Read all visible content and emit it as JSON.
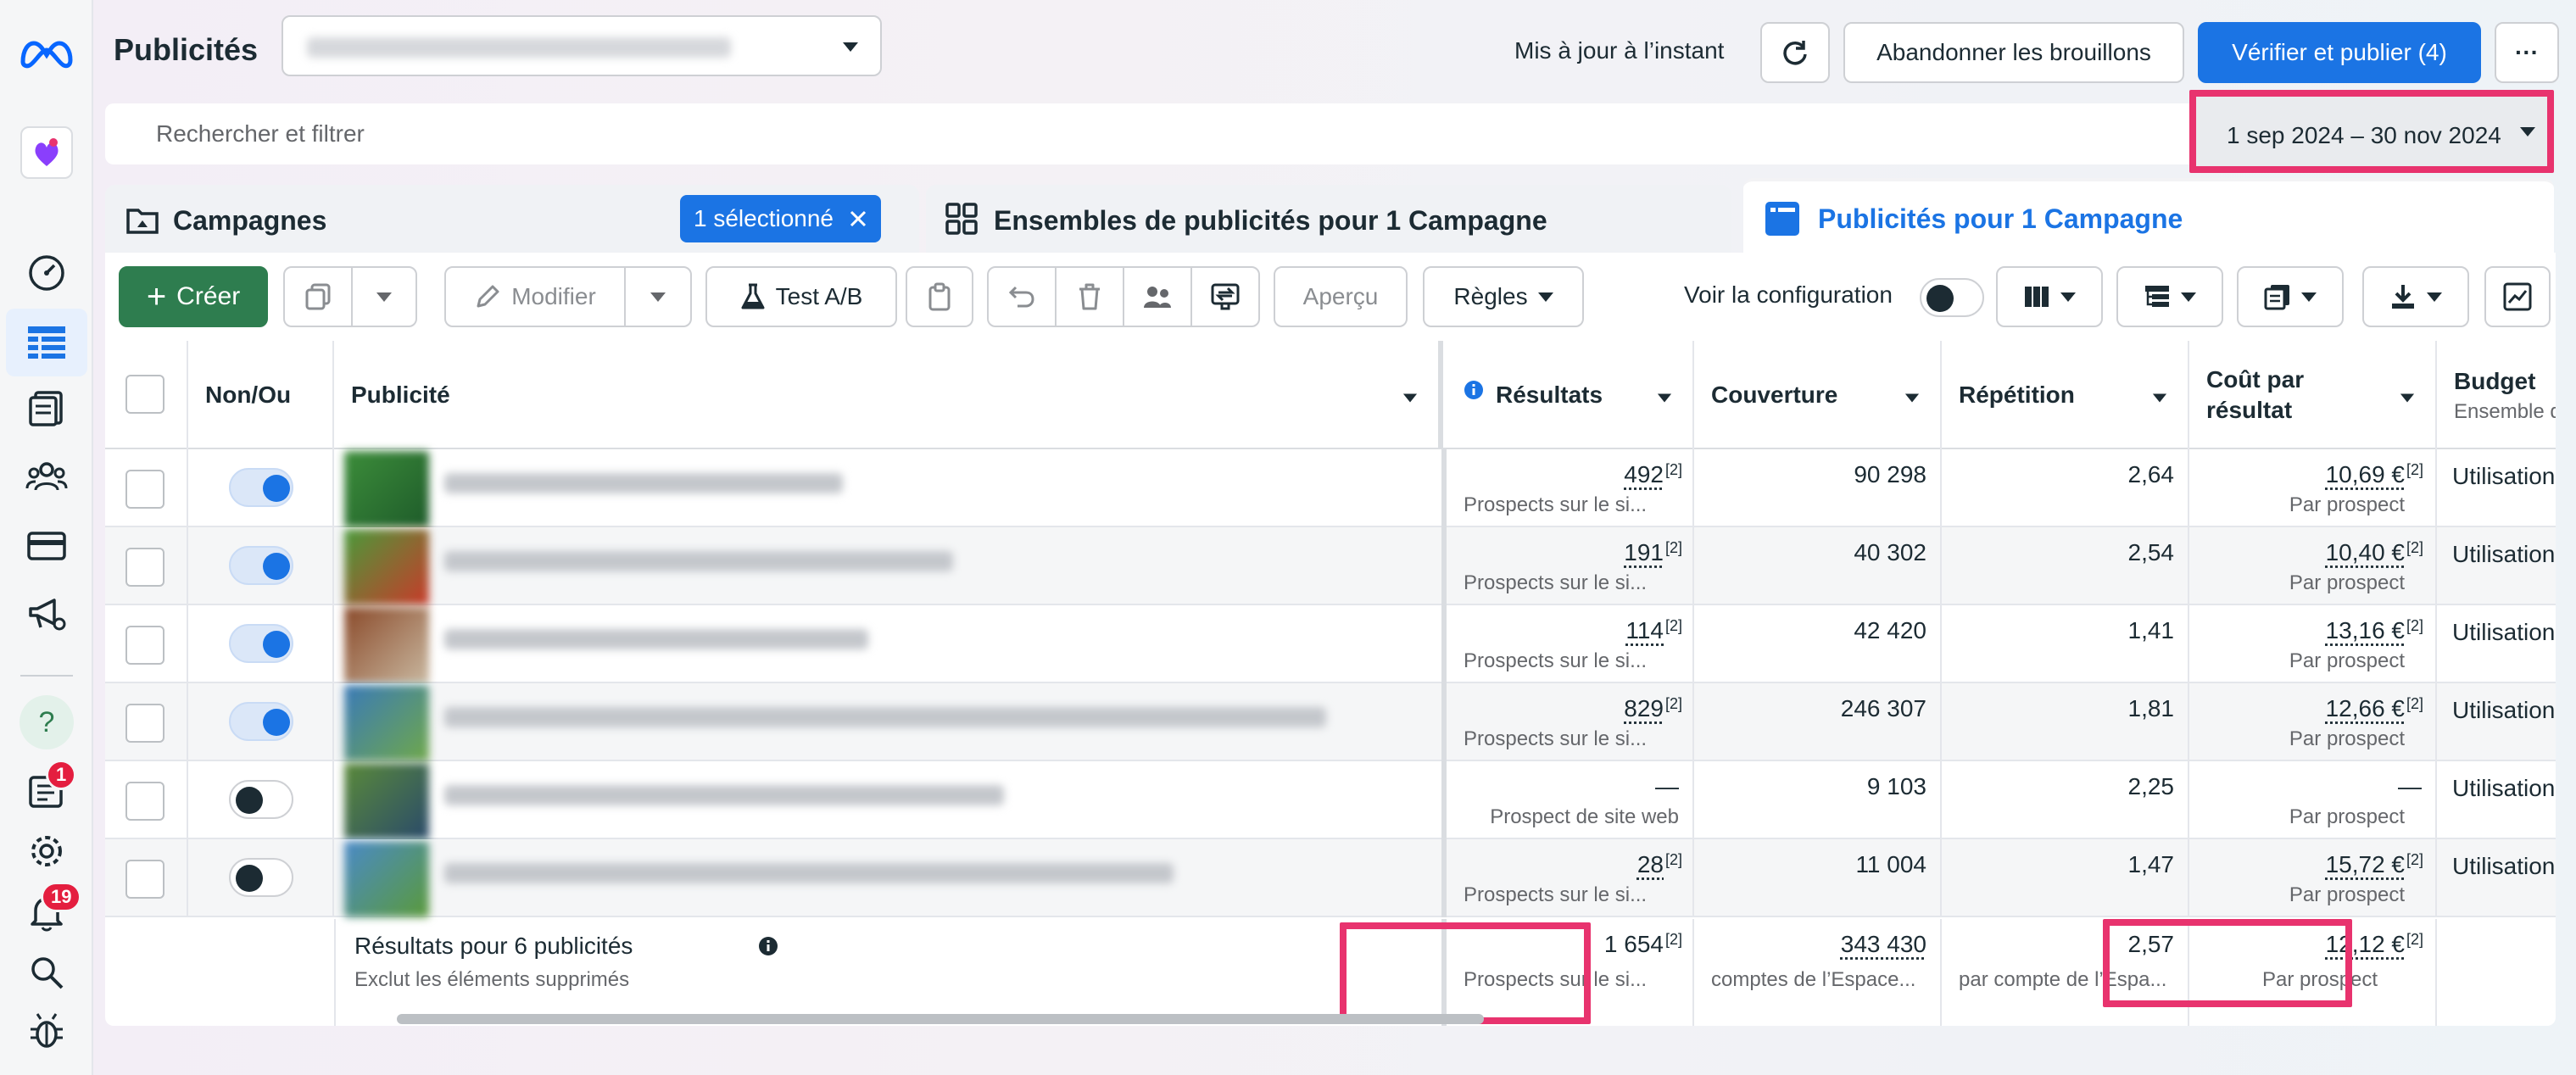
{
  "header": {
    "title": "Publicités",
    "updated": "Mis à jour à l’instant",
    "discard_label": "Abandonner les brouillons",
    "publish_label": "Vérifier et publier (4)",
    "more_label": "···"
  },
  "filter": {
    "search_placeholder": "Rechercher et filtrer",
    "date_range": "1 sep 2024 – 30 nov 2024"
  },
  "tabs": {
    "campaigns": "Campagnes",
    "selected_chip": "1 sélectionné",
    "adsets": "Ensembles de publicités pour 1 Campagne",
    "ads": "Publicités pour 1 Campagne"
  },
  "toolbar": {
    "create": "Créer",
    "edit": "Modifier",
    "ab_test": "Test A/B",
    "preview": "Aperçu",
    "rules": "Règles",
    "view_setup": "Voir la configuration"
  },
  "sidebar": {
    "notifications_badge": "1",
    "alerts_badge": "19"
  },
  "table": {
    "columns": {
      "onoff": "Non/Ou",
      "ad": "Publicité",
      "results": "Résultats",
      "reach": "Couverture",
      "frequency": "Répétition",
      "cpr_line1": "Coût par",
      "cpr_line2": "résultat",
      "budget": "Budget",
      "budget_sub": "Ensemble de publi..."
    },
    "rows": [
      {
        "on": true,
        "results": "492",
        "results_sup": "[2]",
        "results_sub": "Prospects sur le si...",
        "reach": "90 298",
        "frequency": "2,64",
        "cpr": "10,69 €",
        "cpr_sup": "[2]",
        "cpr_sub": "Par prospect",
        "budget": "Utilisation du bu..."
      },
      {
        "on": true,
        "results": "191",
        "results_sup": "[2]",
        "results_sub": "Prospects sur le si...",
        "reach": "40 302",
        "frequency": "2,54",
        "cpr": "10,40 €",
        "cpr_sup": "[2]",
        "cpr_sub": "Par prospect",
        "budget": "Utilisation du bu..."
      },
      {
        "on": true,
        "results": "114",
        "results_sup": "[2]",
        "results_sub": "Prospects sur le si...",
        "reach": "42 420",
        "frequency": "1,41",
        "cpr": "13,16 €",
        "cpr_sup": "[2]",
        "cpr_sub": "Par prospect",
        "budget": "Utilisation du bu..."
      },
      {
        "on": true,
        "results": "829",
        "results_sup": "[2]",
        "results_sub": "Prospects sur le si...",
        "reach": "246 307",
        "frequency": "1,81",
        "cpr": "12,66 €",
        "cpr_sup": "[2]",
        "cpr_sub": "Par prospect",
        "budget": "Utilisation du bu..."
      },
      {
        "on": false,
        "results": "—",
        "results_sup": "",
        "results_sub": "Prospect de site web",
        "reach": "9 103",
        "frequency": "2,25",
        "cpr": "—",
        "cpr_sup": "",
        "cpr_sub": "Par prospect",
        "budget": "Utilisation du bu..."
      },
      {
        "on": false,
        "results": "28",
        "results_sup": "[2]",
        "results_sub": "Prospects sur le si...",
        "reach": "11 004",
        "frequency": "1,47",
        "cpr": "15,72 €",
        "cpr_sup": "[2]",
        "cpr_sub": "Par prospect",
        "budget": "Utilisation du bu..."
      }
    ],
    "summary": {
      "label": "Résultats pour 6 publicités",
      "sub": "Exclut les éléments supprimés",
      "results": "1 654",
      "results_sup": "[2]",
      "results_sub": "Prospects sur le si...",
      "reach": "343 430",
      "reach_sub": "comptes de l’Espace...",
      "frequency": "2,57",
      "frequency_sub": "par compte de l’Espa...",
      "cpr": "12,12 €",
      "cpr_sup": "[2]",
      "cpr_sub": "Par prospect"
    }
  },
  "colors": {
    "accent": "#1b74e4",
    "create_green": "#2e7d4f",
    "highlight_pink": "#e8336e"
  }
}
